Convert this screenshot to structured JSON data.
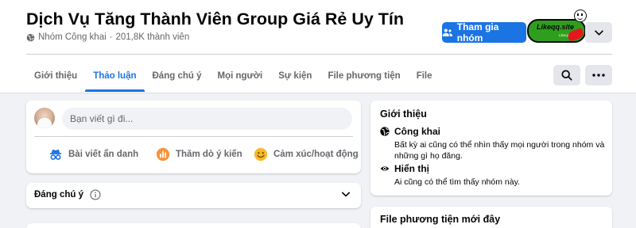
{
  "group": {
    "title": "Dịch Vụ Tăng Thành Viên Group Giá Rẻ Uy Tín",
    "privacy": "Nhóm Công khai",
    "separator": "·",
    "members": "201,8K thành viên"
  },
  "header": {
    "join_label": "Tham gia nhóm",
    "logo_text": "Likeqq.site",
    "logo_sub": "Likeqq.site"
  },
  "tabs": [
    {
      "label": "Giới thiệu"
    },
    {
      "label": "Thảo luận",
      "active": true
    },
    {
      "label": "Đáng chú ý"
    },
    {
      "label": "Mọi người"
    },
    {
      "label": "Sự kiện"
    },
    {
      "label": "File phương tiện"
    },
    {
      "label": "File"
    }
  ],
  "composer": {
    "placeholder": "Bạn viết gì đi...",
    "actions": [
      {
        "label": "Bài viết ẩn danh",
        "icon": "anonymous-icon"
      },
      {
        "label": "Thăm dò ý kiến",
        "icon": "poll-icon"
      },
      {
        "label": "Cảm xúc/hoạt động",
        "icon": "smiley-icon"
      }
    ]
  },
  "highlights": {
    "label": "Đáng chú ý"
  },
  "about": {
    "title": "Giới thiệu",
    "items": [
      {
        "name": "Công khai",
        "desc": "Bất kỳ ai cũng có thể nhìn thấy mọi người trong nhóm và những gì họ đăng.",
        "icon": "globe-icon"
      },
      {
        "name": "Hiển thị",
        "desc": "Ai cũng có thể tìm thấy nhóm này.",
        "icon": "eye-icon"
      }
    ]
  },
  "media": {
    "title": "File phương tiện mới đây"
  },
  "colors": {
    "accent": "#1b74e4",
    "background": "#f0f2f5",
    "secondary_text": "#65676b",
    "anonymous": "#1b74e4",
    "poll": "#f7923b",
    "smiley": "#f7b928"
  }
}
